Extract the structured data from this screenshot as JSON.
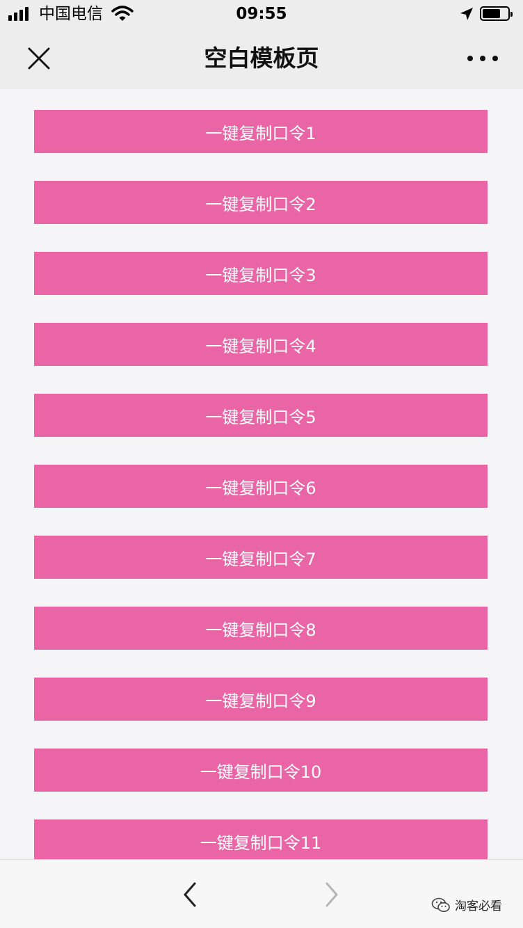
{
  "status_bar": {
    "carrier": "中国电信",
    "time": "09:55",
    "battery_level": 0.7
  },
  "nav": {
    "title": "空白模板页"
  },
  "buttons": [
    {
      "label": "一键复制口令1"
    },
    {
      "label": "一键复制口令2"
    },
    {
      "label": "一键复制口令3"
    },
    {
      "label": "一键复制口令4"
    },
    {
      "label": "一键复制口令5"
    },
    {
      "label": "一键复制口令6"
    },
    {
      "label": "一键复制口令7"
    },
    {
      "label": "一键复制口令8"
    },
    {
      "label": "一键复制口令9"
    },
    {
      "label": "一键复制口令10"
    },
    {
      "label": "一键复制口令11"
    }
  ],
  "watermark": {
    "text": "淘客必看"
  },
  "colors": {
    "button_bg": "#e965a6",
    "button_text": "#ffffff",
    "nav_bg": "#ededed",
    "page_bg": "#f5f5f7"
  },
  "icons": {
    "close": "close-icon",
    "more": "more-icon",
    "back": "back-icon",
    "forward": "forward-icon",
    "wifi": "wifi-icon",
    "location": "location-arrow-icon",
    "battery": "battery-icon",
    "signal": "signal-icon",
    "wechat": "wechat-icon"
  }
}
